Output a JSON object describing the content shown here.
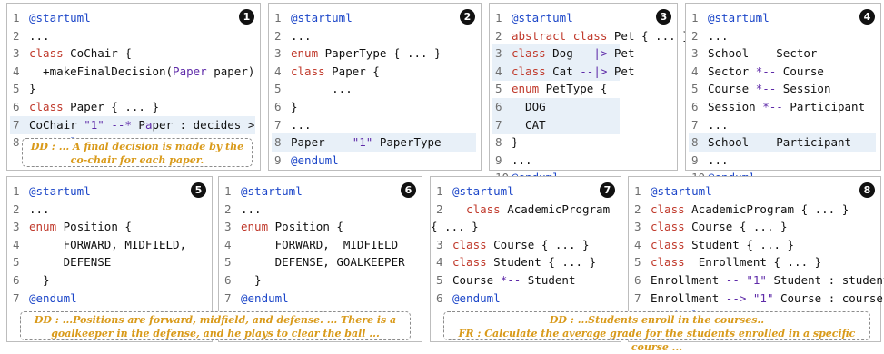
{
  "panels": [
    {
      "badge": "1",
      "lines": [
        [
          {
            "t": "1 ",
            "c": "ln"
          },
          {
            "t": "@startuml",
            "c": "dir"
          }
        ],
        [
          {
            "t": "2 ",
            "c": "ln"
          },
          {
            "t": "...",
            "c": ""
          }
        ],
        [
          {
            "t": "3 ",
            "c": "ln"
          },
          {
            "t": "class ",
            "c": "kw"
          },
          {
            "t": "CoChair {",
            "c": ""
          }
        ],
        [
          {
            "t": "4 ",
            "c": "ln"
          },
          {
            "t": "  +makeFinalDecision(",
            "c": ""
          },
          {
            "t": "Paper",
            "c": "str"
          },
          {
            "t": " paper)",
            "c": ""
          }
        ],
        [
          {
            "t": "5 ",
            "c": "ln"
          },
          {
            "t": "}",
            "c": ""
          }
        ],
        [
          {
            "t": "6 ",
            "c": "ln"
          },
          {
            "t": "class ",
            "c": "kw"
          },
          {
            "t": "Paper { ... }",
            "c": ""
          }
        ],
        [
          {
            "t": "7 ",
            "c": "ln"
          },
          {
            "t": "CoChair ",
            "c": ""
          },
          {
            "t": "\"1\" --*",
            "c": "str"
          },
          {
            "t": " P",
            "c": ""
          },
          {
            "t": "a",
            "c": "str"
          },
          {
            "t": "per : decides >",
            "c": ""
          }
        ],
        [
          {
            "t": "8 ",
            "c": "ln"
          },
          {
            "t": "@enduml",
            "c": "dir"
          }
        ]
      ],
      "highlight": [
        7
      ],
      "note": "DD : ... A final decision is made by the co-chair for each paper."
    },
    {
      "badge": "2",
      "lines": [
        [
          {
            "t": "1 ",
            "c": "ln"
          },
          {
            "t": "@startuml",
            "c": "dir"
          }
        ],
        [
          {
            "t": "2 ",
            "c": "ln"
          },
          {
            "t": "...",
            "c": ""
          }
        ],
        [
          {
            "t": "3 ",
            "c": "ln"
          },
          {
            "t": "enum ",
            "c": "kw"
          },
          {
            "t": "PaperType { ... }",
            "c": ""
          }
        ],
        [
          {
            "t": "4 ",
            "c": "ln"
          },
          {
            "t": "class ",
            "c": "kw"
          },
          {
            "t": "Paper {",
            "c": ""
          }
        ],
        [
          {
            "t": "5 ",
            "c": "ln"
          },
          {
            "t": "      ...",
            "c": ""
          }
        ],
        [
          {
            "t": "6 ",
            "c": "ln"
          },
          {
            "t": "}",
            "c": ""
          }
        ],
        [
          {
            "t": "7 ",
            "c": "ln"
          },
          {
            "t": "...",
            "c": ""
          }
        ],
        [
          {
            "t": "8 ",
            "c": "ln"
          },
          {
            "t": "Paper ",
            "c": ""
          },
          {
            "t": "-- \"1\"",
            "c": "rel"
          },
          {
            "t": " PaperType",
            "c": ""
          }
        ],
        [
          {
            "t": "9",
            "c": "ln"
          },
          {
            "t": "@enduml",
            "c": "dir"
          }
        ]
      ],
      "highlight": [
        8
      ]
    },
    {
      "badge": "3",
      "lines": [
        [
          {
            "t": "1 ",
            "c": "ln"
          },
          {
            "t": "@startuml",
            "c": "dir"
          }
        ],
        [
          {
            "t": "2 ",
            "c": "ln"
          },
          {
            "t": "abstract class ",
            "c": "kw"
          },
          {
            "t": "Pet { ... }",
            "c": ""
          }
        ],
        [
          {
            "t": "3 ",
            "c": "ln"
          },
          {
            "t": "class ",
            "c": "kw"
          },
          {
            "t": "Dog ",
            "c": ""
          },
          {
            "t": "--|>",
            "c": "rel"
          },
          {
            "t": " Pet",
            "c": ""
          }
        ],
        [
          {
            "t": "4 ",
            "c": "ln"
          },
          {
            "t": "class ",
            "c": "kw"
          },
          {
            "t": "Cat ",
            "c": ""
          },
          {
            "t": "--|>",
            "c": "rel"
          },
          {
            "t": " Pet",
            "c": ""
          }
        ],
        [
          {
            "t": "5 ",
            "c": "ln"
          },
          {
            "t": "enum ",
            "c": "kw"
          },
          {
            "t": "PetType {",
            "c": ""
          }
        ],
        [
          {
            "t": "6 ",
            "c": "ln"
          },
          {
            "t": "  DOG",
            "c": ""
          }
        ],
        [
          {
            "t": "7 ",
            "c": "ln"
          },
          {
            "t": "  CAT",
            "c": ""
          }
        ],
        [
          {
            "t": "8 ",
            "c": "ln"
          },
          {
            "t": "}",
            "c": ""
          }
        ],
        [
          {
            "t": "9 ",
            "c": "ln"
          },
          {
            "t": "...",
            "c": ""
          }
        ],
        [
          {
            "t": "10 ",
            "c": "ln"
          },
          {
            "t": "@enduml",
            "c": "dir"
          }
        ]
      ],
      "highlight": [
        3,
        4,
        6,
        7
      ]
    },
    {
      "badge": "4",
      "lines": [
        [
          {
            "t": "1 ",
            "c": "ln"
          },
          {
            "t": "@startuml",
            "c": "dir"
          }
        ],
        [
          {
            "t": "2 ",
            "c": "ln"
          },
          {
            "t": "...",
            "c": ""
          }
        ],
        [
          {
            "t": "3 ",
            "c": "ln"
          },
          {
            "t": "School ",
            "c": ""
          },
          {
            "t": "--",
            "c": "rel"
          },
          {
            "t": " Sector",
            "c": ""
          }
        ],
        [
          {
            "t": "4 ",
            "c": "ln"
          },
          {
            "t": "Sector ",
            "c": ""
          },
          {
            "t": "*--",
            "c": "rel"
          },
          {
            "t": " Course",
            "c": ""
          }
        ],
        [
          {
            "t": "5 ",
            "c": "ln"
          },
          {
            "t": "Course ",
            "c": ""
          },
          {
            "t": "*--",
            "c": "rel"
          },
          {
            "t": " Session",
            "c": ""
          }
        ],
        [
          {
            "t": "6 ",
            "c": "ln"
          },
          {
            "t": "Session ",
            "c": ""
          },
          {
            "t": "*--",
            "c": "rel"
          },
          {
            "t": " Participant",
            "c": ""
          }
        ],
        [
          {
            "t": "7 ",
            "c": "ln"
          },
          {
            "t": "...",
            "c": ""
          }
        ],
        [
          {
            "t": "8 ",
            "c": "ln"
          },
          {
            "t": "School ",
            "c": ""
          },
          {
            "t": "--",
            "c": "rel"
          },
          {
            "t": " Participant",
            "c": ""
          }
        ],
        [
          {
            "t": "9 ",
            "c": "ln"
          },
          {
            "t": "...",
            "c": ""
          }
        ],
        [
          {
            "t": "10 ",
            "c": "ln"
          },
          {
            "t": "@enduml",
            "c": "dir"
          }
        ]
      ],
      "highlight": [
        8
      ]
    },
    {
      "badge": "5",
      "lines": [
        [
          {
            "t": "1 ",
            "c": "ln"
          },
          {
            "t": "@startuml",
            "c": "dir"
          }
        ],
        [
          {
            "t": "2 ",
            "c": "ln"
          },
          {
            "t": "...",
            "c": ""
          }
        ],
        [
          {
            "t": "3 ",
            "c": "ln"
          },
          {
            "t": "enum ",
            "c": "kw"
          },
          {
            "t": "Position {",
            "c": ""
          }
        ],
        [
          {
            "t": "4 ",
            "c": "ln"
          },
          {
            "t": "     FORWARD, MIDFIELD,",
            "c": ""
          }
        ],
        [
          {
            "t": "5 ",
            "c": "ln"
          },
          {
            "t": "     DEFENSE",
            "c": ""
          }
        ],
        [
          {
            "t": "6 ",
            "c": "ln"
          },
          {
            "t": "  }",
            "c": ""
          }
        ],
        [
          {
            "t": "7 ",
            "c": "ln"
          },
          {
            "t": "@enduml",
            "c": "dir"
          }
        ]
      ],
      "highlight": []
    },
    {
      "badge": "6",
      "lines": [
        [
          {
            "t": "1 ",
            "c": "ln"
          },
          {
            "t": "@startuml",
            "c": "dir"
          }
        ],
        [
          {
            "t": "2 ",
            "c": "ln"
          },
          {
            "t": "...",
            "c": ""
          }
        ],
        [
          {
            "t": "3 ",
            "c": "ln"
          },
          {
            "t": "enum ",
            "c": "kw"
          },
          {
            "t": "Position {",
            "c": ""
          }
        ],
        [
          {
            "t": "4 ",
            "c": "ln"
          },
          {
            "t": "     FORWARD,  MIDFIELD",
            "c": ""
          }
        ],
        [
          {
            "t": "5 ",
            "c": "ln"
          },
          {
            "t": "     DEFENSE, GOALKEEPER",
            "c": ""
          }
        ],
        [
          {
            "t": "6 ",
            "c": "ln"
          },
          {
            "t": "  }",
            "c": ""
          }
        ],
        [
          {
            "t": "7 ",
            "c": "ln"
          },
          {
            "t": "@enduml",
            "c": "dir"
          }
        ]
      ],
      "highlight": []
    },
    {
      "badge": "7",
      "lines": [
        [
          {
            "t": "1 ",
            "c": "ln"
          },
          {
            "t": "@startuml",
            "c": "dir"
          }
        ],
        [
          {
            "t": "2 ",
            "c": "ln"
          },
          {
            "t": "  class ",
            "c": "kw"
          },
          {
            "t": "AcademicProgram",
            "c": ""
          }
        ],
        [
          {
            "t": "",
            "c": ""
          },
          {
            "t": "{ ... }",
            "c": ""
          }
        ],
        [
          {
            "t": "3 ",
            "c": "ln"
          },
          {
            "t": "class ",
            "c": "kw"
          },
          {
            "t": "Course { ... }",
            "c": ""
          }
        ],
        [
          {
            "t": "4 ",
            "c": "ln"
          },
          {
            "t": "class ",
            "c": "kw"
          },
          {
            "t": "Student { ... }",
            "c": ""
          }
        ],
        [
          {
            "t": "5 ",
            "c": "ln"
          },
          {
            "t": "Course ",
            "c": ""
          },
          {
            "t": "*--",
            "c": "rel"
          },
          {
            "t": " Student",
            "c": ""
          }
        ],
        [
          {
            "t": "6 ",
            "c": "ln"
          },
          {
            "t": "@enduml",
            "c": "dir"
          }
        ]
      ],
      "highlight": []
    },
    {
      "badge": "8",
      "lines": [
        [
          {
            "t": "1 ",
            "c": "ln"
          },
          {
            "t": "@startuml",
            "c": "dir"
          }
        ],
        [
          {
            "t": "2 ",
            "c": "ln"
          },
          {
            "t": "class ",
            "c": "kw"
          },
          {
            "t": "AcademicProgram { ... }",
            "c": ""
          }
        ],
        [
          {
            "t": "3 ",
            "c": "ln"
          },
          {
            "t": "class ",
            "c": "kw"
          },
          {
            "t": "Course { ... }",
            "c": ""
          }
        ],
        [
          {
            "t": "4 ",
            "c": "ln"
          },
          {
            "t": "class ",
            "c": "kw"
          },
          {
            "t": "Student { ... }",
            "c": ""
          }
        ],
        [
          {
            "t": "5 ",
            "c": "ln"
          },
          {
            "t": "class  ",
            "c": "kw"
          },
          {
            "t": "Enrollment { ... }",
            "c": ""
          }
        ],
        [
          {
            "t": "6 ",
            "c": "ln"
          },
          {
            "t": "Enrollment ",
            "c": ""
          },
          {
            "t": "-- \"1\"",
            "c": "rel"
          },
          {
            "t": " Student : student",
            "c": ""
          }
        ],
        [
          {
            "t": "7 ",
            "c": "ln"
          },
          {
            "t": "Enrollment ",
            "c": ""
          },
          {
            "t": "--> \"1\"",
            "c": "rel"
          },
          {
            "t": " Course : course",
            "c": ""
          }
        ],
        [
          {
            "t": "8 ",
            "c": "ln"
          },
          {
            "t": "@enduml",
            "c": "dir"
          }
        ]
      ],
      "highlight": []
    }
  ],
  "notes": {
    "bottom_left": "DD : ...Positions are forward, midfield, and defense. ... There is a goalkeeper in the defense, and he plays to clear the ball ...",
    "bottom_right_dd": "DD : ...Students enroll in the courses..",
    "bottom_right_fr": "FR : Calculate the average grade for the students enrolled in a specific course ..."
  },
  "colors": {
    "keyword": "#c0392b",
    "directive": "#1d47c9",
    "relation": "#5e2aa8",
    "note_text": "#d99a1a",
    "highlight": "#e8f0f8"
  }
}
